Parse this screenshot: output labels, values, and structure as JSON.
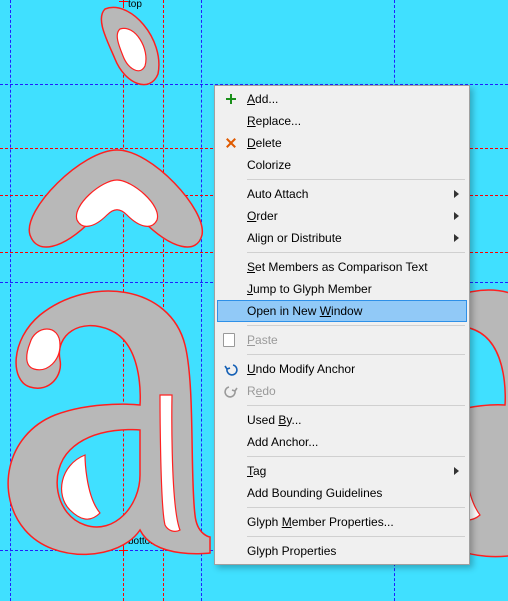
{
  "anchors": {
    "top_label": "top",
    "bottom_label": "bottom"
  },
  "menu": {
    "add": "Add...",
    "replace": "Replace...",
    "delete": "Delete",
    "colorize": "Colorize",
    "auto_attach": "Auto Attach",
    "order": "Order",
    "align": "Align or Distribute",
    "set_members": "Set Members as Comparison Text",
    "jump": "Jump to Glyph Member",
    "open_new": "Open in New Window",
    "paste": "Paste",
    "undo": "Undo Modify Anchor",
    "redo": "Redo",
    "used_by": "Used By...",
    "add_anchor": "Add Anchor...",
    "tag": "Tag",
    "add_bbox": "Add Bounding Guidelines",
    "member_props": "Glyph Member Properties...",
    "glyph_props": "Glyph Properties"
  }
}
